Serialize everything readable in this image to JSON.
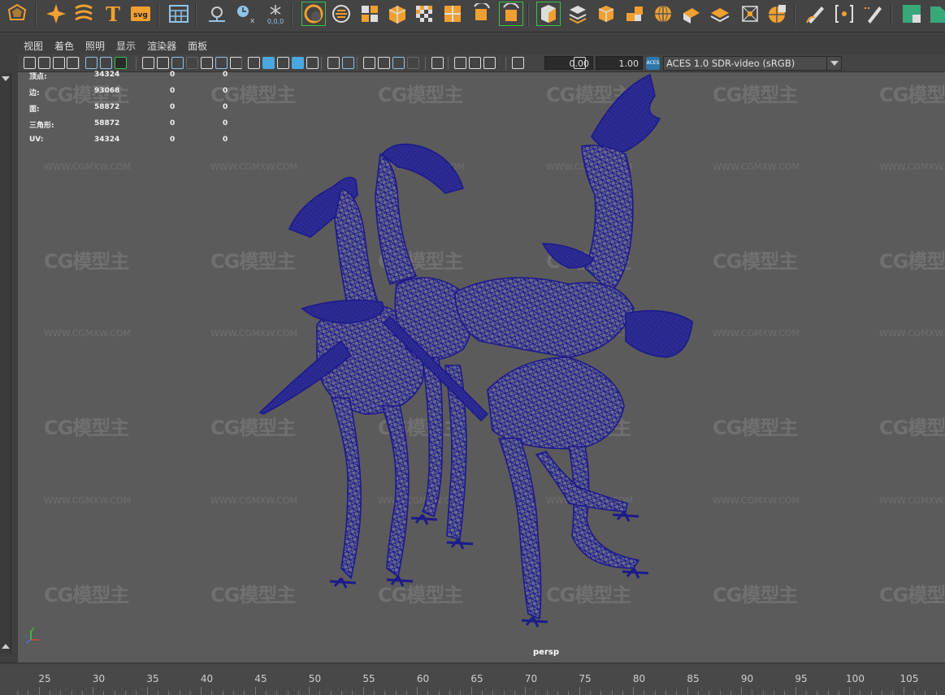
{
  "shelf": {
    "icons": [
      "polygon-icon",
      "sparkle-star-icon",
      "bend-text-icon",
      "text-icon",
      "svg-icon",
      "grid-panel-icon",
      "measure-distance-icon",
      "clock-param-icon",
      "snowflake-icon",
      "cage-ring-icon",
      "circle-tool-icon",
      "quad-split-icon",
      "box-open-icon",
      "checker-grid-icon",
      "quad-fill-icon",
      "rotate-quad-icon",
      "rotate-quad-highlight-icon",
      "cube-corner-icon",
      "stack-layers-icon",
      "cube-orange-icon",
      "cubes-group-icon",
      "sphere-grid-icon",
      "cube-slant-icon",
      "layers-flat-icon",
      "bounding-box-icon",
      "sphere-cut-icon",
      "pen-curve-icon",
      "bracket-select-icon",
      "pen-dotted-icon",
      "cube-green-icon",
      "cube-tail-icon"
    ],
    "snowflake_value": "0,0,0",
    "svg_label": "svg"
  },
  "panel_menu": [
    "视图",
    "着色",
    "照明",
    "显示",
    "渲染器",
    "面板"
  ],
  "toolbar": {
    "exposure_value": "0.00",
    "gamma_value": "1.00",
    "colorspace": "ACES 1.0 SDR-video (sRGB)",
    "aces_badge": "ACES"
  },
  "hud": {
    "rows": [
      {
        "label": "顶点:",
        "v1": "34324",
        "v2": "0",
        "v3": "0"
      },
      {
        "label": "边:",
        "v1": "93068",
        "v2": "0",
        "v3": "0"
      },
      {
        "label": "面:",
        "v1": "58872",
        "v2": "0",
        "v3": "0"
      },
      {
        "label": "三角形:",
        "v1": "58872",
        "v2": "0",
        "v3": "0"
      },
      {
        "label": "UV:",
        "v1": "34324",
        "v2": "0",
        "v3": "0"
      }
    ]
  },
  "viewport": {
    "camera": "persp",
    "background": "#5b5b5b",
    "wireframe_color": "#1d1a8c",
    "watermark_logo": "CG模型主",
    "watermark_url": "WWW.CGMXW.COM"
  },
  "timeline": {
    "ticks": [
      "25",
      "30",
      "35",
      "40",
      "45",
      "50",
      "55",
      "60",
      "65",
      "70",
      "75",
      "80",
      "85",
      "90",
      "95",
      "100",
      "105"
    ]
  },
  "colors": {
    "accent_orange": "#f0a030",
    "highlight_green": "#39c24a",
    "wire_blue": "#1d1a8c"
  }
}
